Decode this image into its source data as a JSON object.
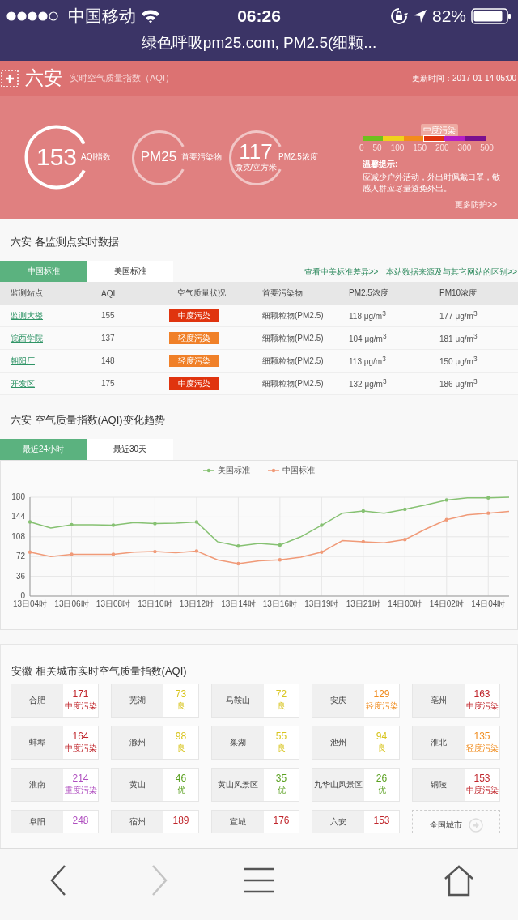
{
  "status_bar": {
    "carrier": "中国移动",
    "time": "06:26",
    "battery": "82%"
  },
  "url_bar": {
    "title": "绿色呼吸pm25.com, PM2.5(细颗..."
  },
  "header": {
    "city": "六安",
    "subtitle": "实时空气质量指数（AQI）",
    "updated": "更新时间：2017-01-14 05:00"
  },
  "summary": {
    "gauges": [
      {
        "value": "153",
        "label": "AQI指数",
        "primary": true
      },
      {
        "value": "PM25",
        "label": "首要污染物",
        "primary": false
      },
      {
        "value": "117",
        "unit": "微克/立方米",
        "label": "PM2.5浓度",
        "primary": false
      }
    ],
    "scale": {
      "marker": "中度污染",
      "segments": [
        {
          "color": "#6ec01e",
          "selected": false
        },
        {
          "color": "#f0d21c",
          "selected": false
        },
        {
          "color": "#f38c1c",
          "selected": false
        },
        {
          "color": "#e0340f",
          "selected": true
        },
        {
          "color": "#b41fc4",
          "selected": false
        },
        {
          "color": "#7a108e",
          "selected": false
        }
      ],
      "ticks": [
        "0",
        "50",
        "100",
        "150",
        "200",
        "300",
        "500"
      ]
    },
    "tips": {
      "title": "温馨提示:",
      "text": "应减少户外活动，外出时佩戴口罩，敏感人群应尽量避免外出。"
    },
    "more_link": "更多防护>>"
  },
  "stations": {
    "title": "六安 各监测点实时数据",
    "tabs": [
      {
        "label": "中国标准",
        "selected": true
      },
      {
        "label": "美国标准",
        "selected": false
      }
    ],
    "links": [
      "查看中美标准差异>>",
      "本站数据来源及与其它网站的区别>>"
    ],
    "table": {
      "columns": [
        "监测站点",
        "AQI",
        "空气质量状况",
        "首要污染物",
        "PM2.5浓度",
        "PM10浓度"
      ],
      "rows": [
        {
          "station": "监测大楼",
          "aqi": "155",
          "status": "中度污染",
          "color": "#e0340f",
          "pollutant": "细颗粒物(PM2.5)",
          "pm25": "118 μg/m$^{3}$",
          "pm10": "177 μg/m$^{3}$"
        },
        {
          "station": "皖西学院",
          "aqi": "137",
          "status": "轻度污染",
          "color": "#f08028",
          "pollutant": "细颗粒物(PM2.5)",
          "pm25": "104 μg/m$^{3}$",
          "pm10": "181 μg/m$^{3}$"
        },
        {
          "station": "朝阳厂",
          "aqi": "148",
          "status": "轻度污染",
          "color": "#f08028",
          "pollutant": "细颗粒物(PM2.5)",
          "pm25": "113 μg/m$^{3}$",
          "pm10": "150 μg/m$^{3}$"
        },
        {
          "station": "开发区",
          "aqi": "175",
          "status": "中度污染",
          "color": "#e0340f",
          "pollutant": "细颗粒物(PM2.5)",
          "pm25": "132 μg/m$^{3}$",
          "pm10": "186 μg/m$^{3}$"
        }
      ]
    }
  },
  "trend": {
    "title": "六安 空气质量指数(AQI)变化趋势",
    "tabs": [
      {
        "label": "最近24小时",
        "selected": true
      },
      {
        "label": "最近30天",
        "selected": false
      }
    ],
    "chart_data": {
      "type": "line",
      "categories": [
        "13日04时",
        null,
        "13日06时",
        null,
        "13日08时",
        null,
        "13日10时",
        null,
        "13日12时",
        null,
        "13日14时",
        null,
        "13日16时",
        null,
        "13日19时",
        null,
        "13日21时",
        null,
        "14日00时",
        null,
        "14日02时",
        null,
        "14日04时",
        null
      ],
      "ylim": [
        0,
        180
      ],
      "yticks": [
        {
          "value": 0,
          "label": "0"
        },
        {
          "value": 36,
          "label": "36"
        },
        {
          "value": 72,
          "label": "72"
        },
        {
          "value": 108,
          "label": "108"
        },
        {
          "value": 144,
          "label": "144"
        },
        {
          "value": 180,
          "label": "180"
        }
      ],
      "grid": true,
      "legend": "top",
      "series": [
        {
          "name": "美国标准",
          "color": "#86c172",
          "values": [
            135,
            124,
            130,
            130,
            129,
            134,
            132,
            133,
            135,
            99,
            91,
            96,
            93,
            108,
            129,
            151,
            155,
            151,
            158,
            166,
            175,
            179,
            179,
            180
          ]
        },
        {
          "name": "中国标准",
          "color": "#f09a78",
          "values": [
            80,
            72,
            76,
            76,
            76,
            80,
            81,
            79,
            82,
            66,
            59,
            64,
            66,
            71,
            80,
            101,
            99,
            97,
            103,
            122,
            139,
            148,
            151,
            154
          ]
        }
      ]
    }
  },
  "cities": {
    "title": "安徽 相关城市实时空气质量指数(AQI)",
    "items": [
      {
        "kind": "city",
        "name": "合肥",
        "aqi": "171",
        "level": "中度污染",
        "color": "#c0262c"
      },
      {
        "kind": "city",
        "name": "芜湖",
        "aqi": "73",
        "level": "良",
        "color": "#d8c41e"
      },
      {
        "kind": "city",
        "name": "马鞍山",
        "aqi": "72",
        "level": "良",
        "color": "#d8c41e"
      },
      {
        "kind": "city",
        "name": "安庆",
        "aqi": "129",
        "level": "轻度污染",
        "color": "#f08c1e"
      },
      {
        "kind": "city",
        "name": "亳州",
        "aqi": "163",
        "level": "中度污染",
        "color": "#c0262c"
      },
      {
        "kind": "city",
        "name": "蚌埠",
        "aqi": "164",
        "level": "中度污染",
        "color": "#c0262c"
      },
      {
        "kind": "city",
        "name": "滁州",
        "aqi": "98",
        "level": "良",
        "color": "#d8c41e"
      },
      {
        "kind": "city",
        "name": "巢湖",
        "aqi": "55",
        "level": "良",
        "color": "#d8c41e"
      },
      {
        "kind": "city",
        "name": "池州",
        "aqi": "94",
        "level": "良",
        "color": "#d8c41e"
      },
      {
        "kind": "city",
        "name": "淮北",
        "aqi": "135",
        "level": "轻度污染",
        "color": "#f08c1e"
      },
      {
        "kind": "city",
        "name": "淮南",
        "aqi": "214",
        "level": "重度污染",
        "color": "#b050c0"
      },
      {
        "kind": "city",
        "name": "黄山",
        "aqi": "46",
        "level": "优",
        "color": "#5aa020"
      },
      {
        "kind": "city",
        "name": "黄山风景区",
        "aqi": "35",
        "level": "优",
        "color": "#5aa020"
      },
      {
        "kind": "city",
        "name": "九华山风景区",
        "aqi": "26",
        "level": "优",
        "color": "#5aa020"
      },
      {
        "kind": "city",
        "name": "铜陵",
        "aqi": "153",
        "level": "中度污染",
        "color": "#c0262c"
      },
      {
        "kind": "city",
        "name": "阜阳",
        "aqi": "248",
        "color": "#b050c0"
      },
      {
        "kind": "city",
        "name": "宿州",
        "aqi": "189",
        "color": "#c0262c"
      },
      {
        "kind": "city",
        "name": "宣城",
        "aqi": "176",
        "color": "#c0262c"
      },
      {
        "kind": "city",
        "name": "六安",
        "aqi": "153",
        "color": "#c0262c"
      },
      {
        "kind": "link",
        "name": "全国城市"
      }
    ]
  },
  "toolbar": {
    "buttons": [
      {
        "kind": "back",
        "disabled": false
      },
      {
        "kind": "forward",
        "disabled": true
      },
      {
        "kind": "menu",
        "disabled": false
      },
      {
        "kind": "home",
        "disabled": false
      }
    ]
  }
}
